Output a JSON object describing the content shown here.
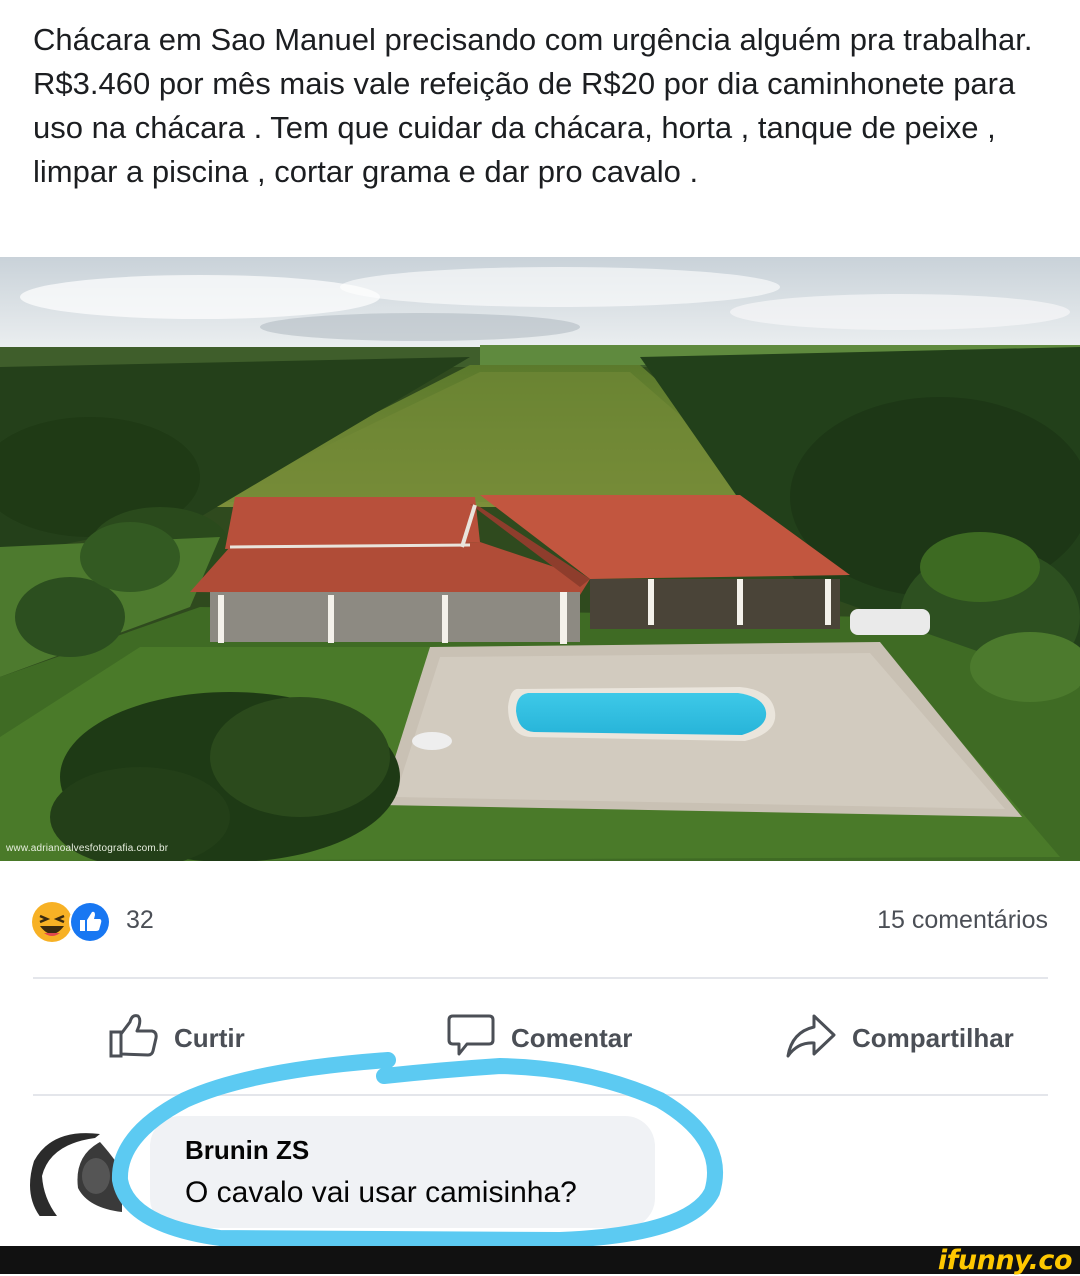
{
  "post": {
    "text": "Chácara em Sao Manuel precisando com urgência alguém pra trabalhar. R$3.460 por mês mais vale refeição de R$20 por dia caminhonete para uso na chácara . Tem que cuidar da chácara, horta , tanque de peixe , limpar a piscina , cortar grama e dar pro cavalo .",
    "photo_watermark": "www.adrianoalvesfotografia.com.br"
  },
  "reactions": {
    "icons": [
      "laughing-emoji-icon",
      "like-thumb-icon"
    ],
    "count": "32",
    "comments_count": "15 comentários"
  },
  "actions": {
    "like_label": "Curtir",
    "comment_label": "Comentar",
    "share_label": "Compartilhar"
  },
  "comment": {
    "author": "Brunin ZS",
    "text": "O cavalo vai usar camisinha?"
  },
  "footer": {
    "logo": "ifunny.co"
  },
  "colors": {
    "reaction_like_blue": "#1877f2",
    "reaction_haha_yellow": "#f7b125",
    "highlight_circle": "#5ccaf2",
    "footer_bar": "#111111",
    "logo_yellow": "#ffc800"
  }
}
